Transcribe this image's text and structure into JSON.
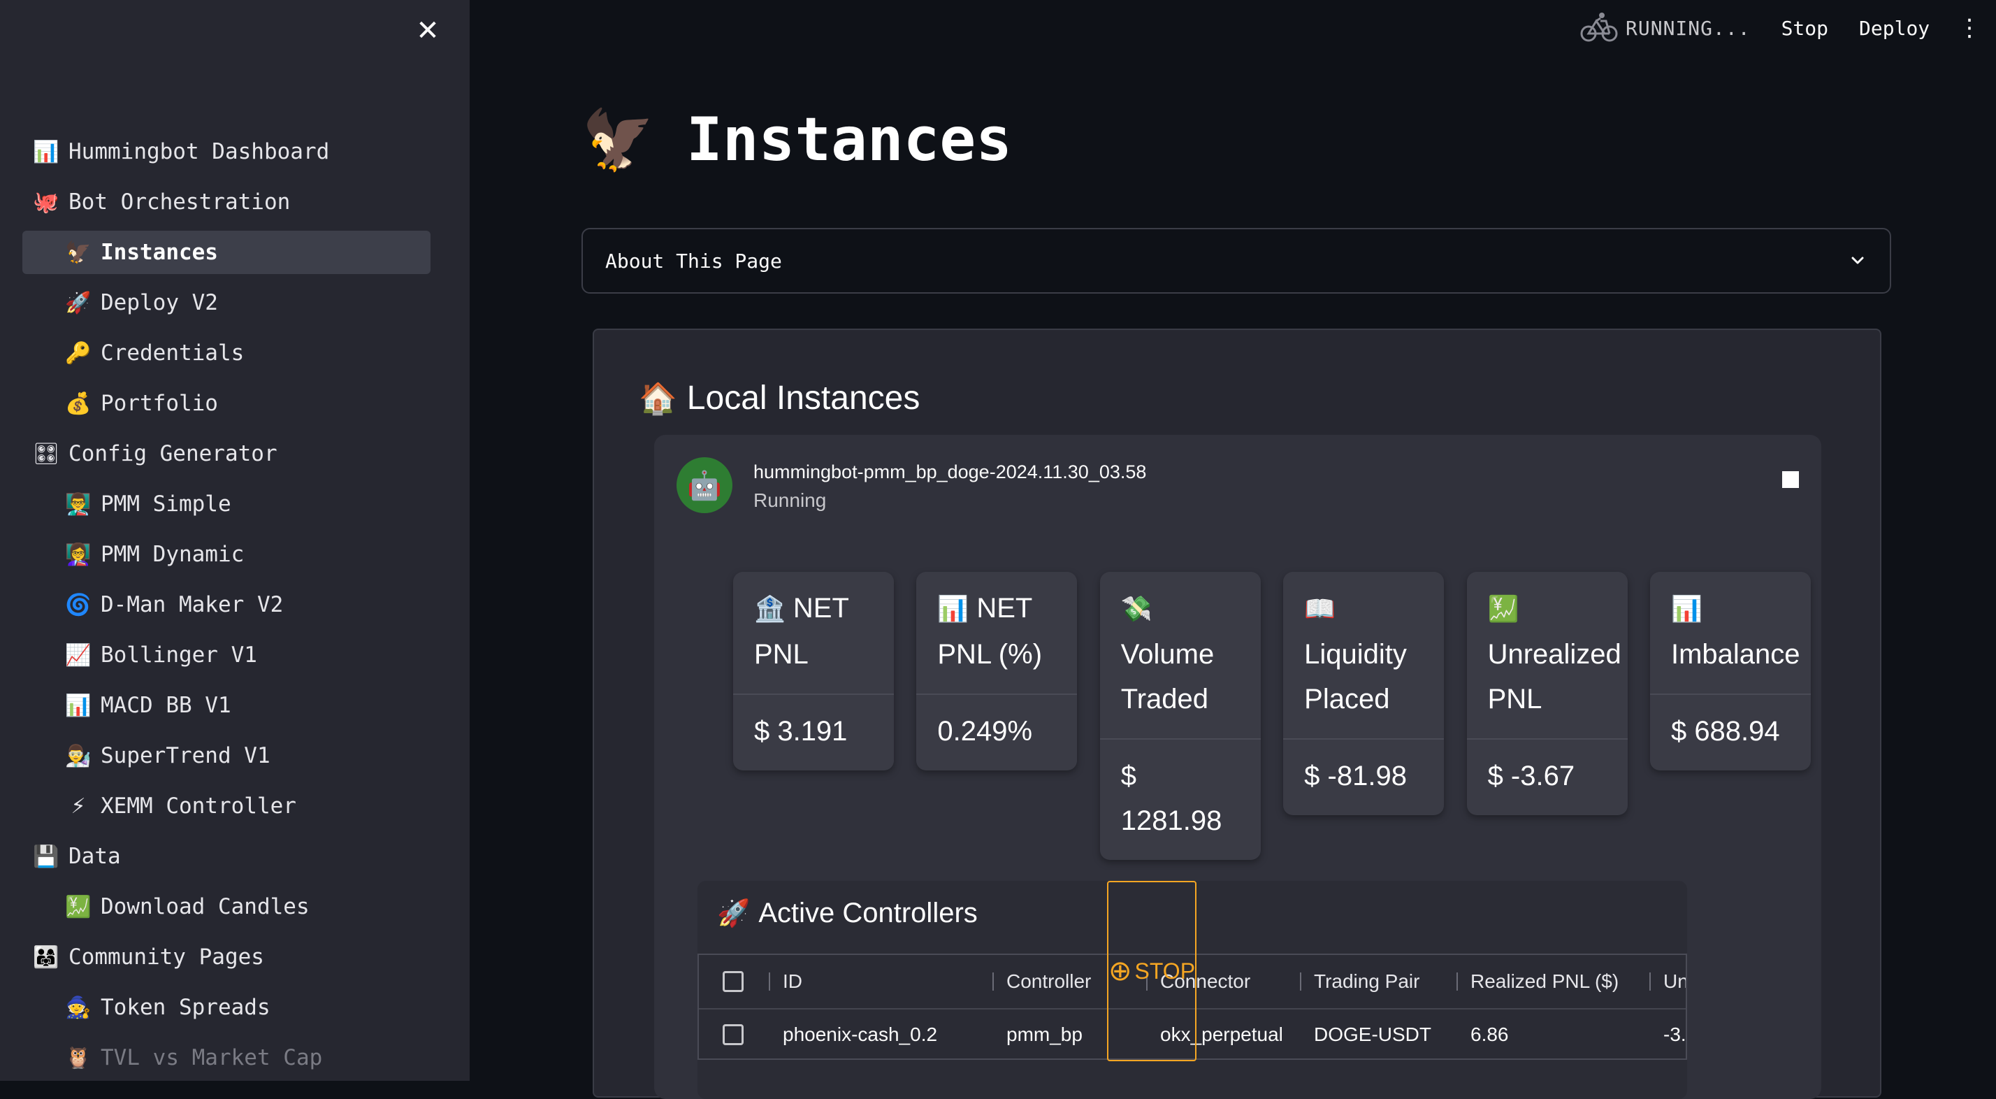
{
  "sidebar": {
    "items": [
      {
        "icon": "📊",
        "label": "Hummingbot Dashboard",
        "level": "top"
      },
      {
        "icon": "🐙",
        "label": "Bot Orchestration",
        "level": "top"
      },
      {
        "icon": "🦅",
        "label": "Instances",
        "level": "sub",
        "active": true
      },
      {
        "icon": "🚀",
        "label": "Deploy V2",
        "level": "sub"
      },
      {
        "icon": "🔑",
        "label": "Credentials",
        "level": "sub"
      },
      {
        "icon": "💰",
        "label": "Portfolio",
        "level": "sub"
      },
      {
        "icon": "🎛",
        "label": "Config Generator",
        "level": "top"
      },
      {
        "icon": "👨‍🏫",
        "label": "PMM Simple",
        "level": "sub"
      },
      {
        "icon": "👩‍🏫",
        "label": "PMM Dynamic",
        "level": "sub"
      },
      {
        "icon": "🌀",
        "label": "D-Man Maker V2",
        "level": "sub"
      },
      {
        "icon": "📈",
        "label": "Bollinger V1",
        "level": "sub"
      },
      {
        "icon": "📊",
        "label": "MACD BB V1",
        "level": "sub"
      },
      {
        "icon": "👨‍🔬",
        "label": "SuperTrend V1",
        "level": "sub"
      },
      {
        "icon": "⚡",
        "label": "XEMM Controller",
        "level": "sub"
      },
      {
        "icon": "💾",
        "label": "Data",
        "level": "top"
      },
      {
        "icon": "💹",
        "label": "Download Candles",
        "level": "sub"
      },
      {
        "icon": "👨‍👩‍👧",
        "label": "Community Pages",
        "level": "top"
      },
      {
        "icon": "🧙",
        "label": "Token Spreads",
        "level": "sub"
      },
      {
        "icon": "🦉",
        "label": "TVL vs Market Cap",
        "level": "sub",
        "faded": true
      }
    ]
  },
  "toolbar": {
    "status": "RUNNING...",
    "stop_label": "Stop",
    "deploy_label": "Deploy"
  },
  "page": {
    "title_icon": "🦅",
    "title": "Instances",
    "expander_label": "About This Page"
  },
  "panel": {
    "title_icon": "🏠",
    "title": "Local Instances",
    "instance": {
      "avatar_icon": "🤖",
      "name": "hummingbot-pmm_bp_doge-2024.11.30_03.58",
      "status": "Running",
      "metrics": [
        {
          "icon": "🏦",
          "label": "NET PNL",
          "value": "$ 3.191"
        },
        {
          "icon": "📊",
          "label": "NET PNL (%)",
          "value": "0.249%"
        },
        {
          "icon": "💸",
          "label": "Volume Traded",
          "value": "$ 1281.98"
        },
        {
          "icon": "📖",
          "label": "Liquidity Placed",
          "value": "$ -81.98"
        },
        {
          "icon": "💹",
          "label": "Unrealized PNL",
          "value": "$ -3.67"
        },
        {
          "icon": "📊",
          "label": "Imbalance",
          "value": "$ 688.94"
        }
      ],
      "controllers": {
        "title_icon": "🚀",
        "title": "Active Controllers",
        "columns": [
          "ID",
          "Controller",
          "Connector",
          "Trading Pair",
          "Realized PNL ($)",
          "Un"
        ],
        "rows": [
          [
            "phoenix-cash_0.2",
            "pmm_bp",
            "okx_perpetual",
            "DOGE-USDT",
            "6.86",
            "-3."
          ]
        ],
        "stop_icon": "⊕",
        "stop_label": "STOP"
      }
    }
  }
}
